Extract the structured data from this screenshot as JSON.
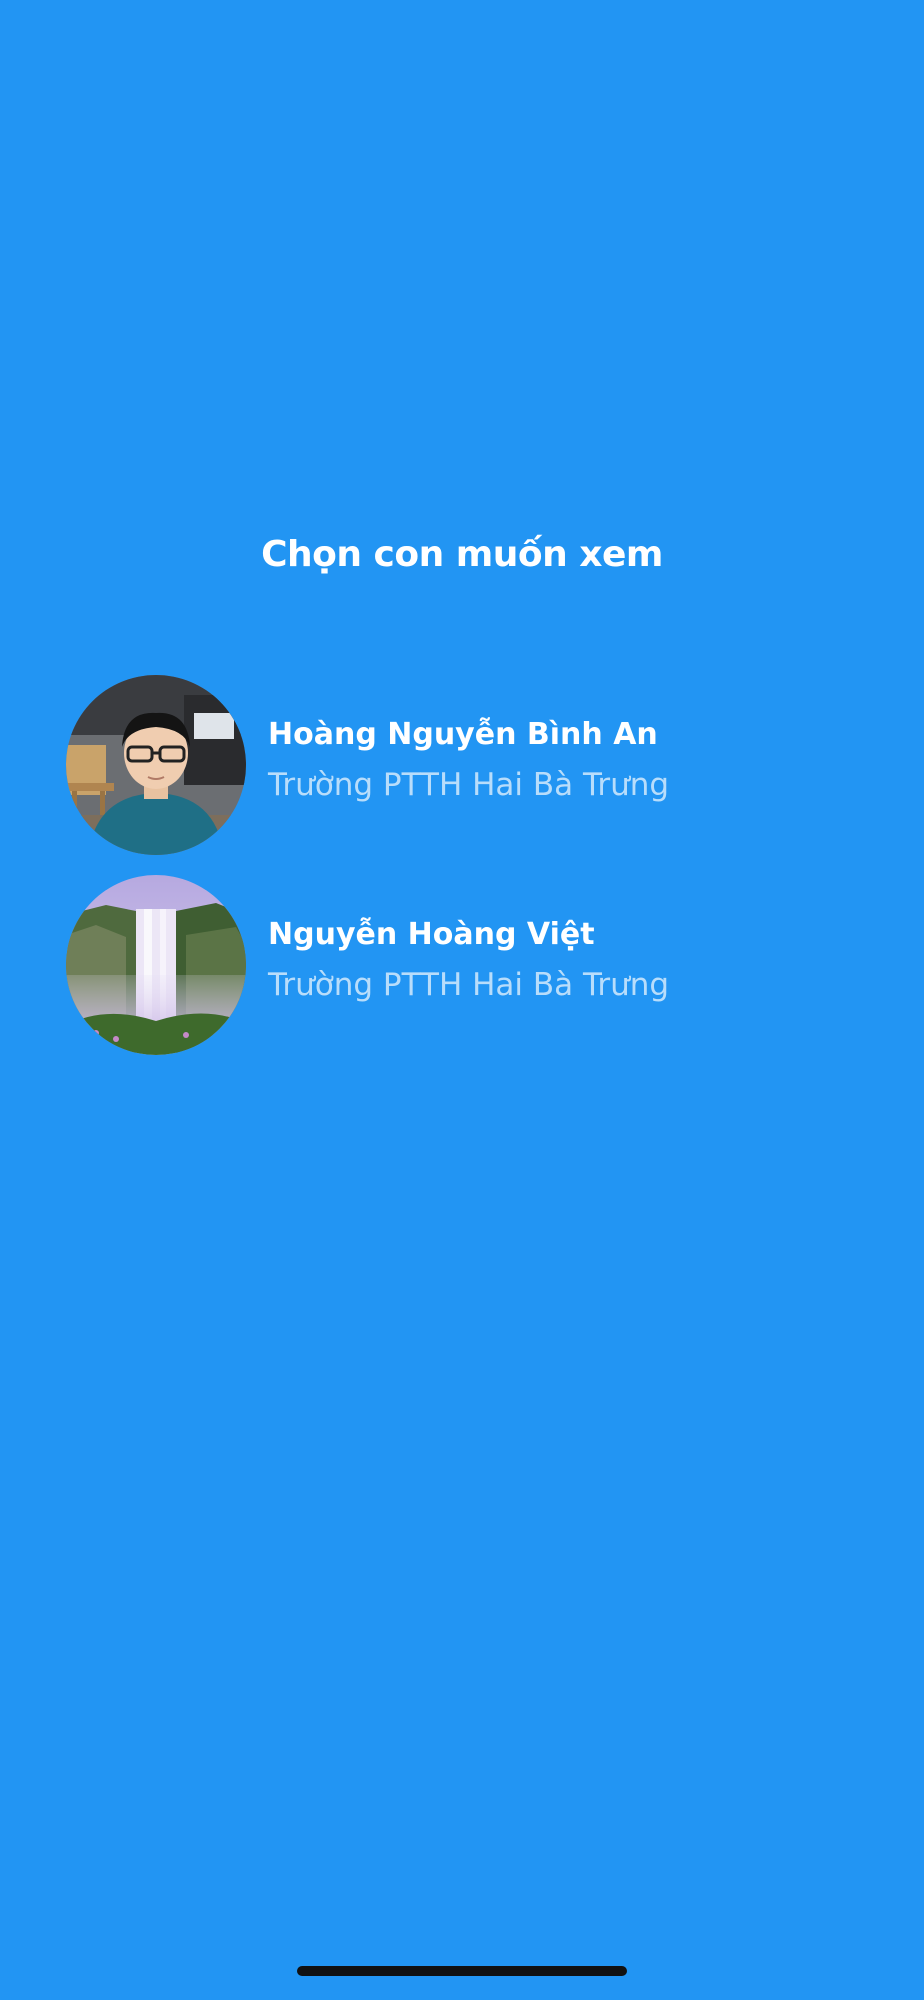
{
  "screen": {
    "title": "Chọn con muốn xem",
    "background_color": "#2295F3"
  },
  "children": [
    {
      "name": "Hoàng Nguyễn Bình An",
      "school": "Trường PTTH Hai Bà Trưng",
      "avatar_icon": "boy-photo-avatar"
    },
    {
      "name": "Nguyễn Hoàng Việt",
      "school": "Trường PTTH Hai Bà Trưng",
      "avatar_icon": "waterfall-photo-avatar"
    }
  ]
}
